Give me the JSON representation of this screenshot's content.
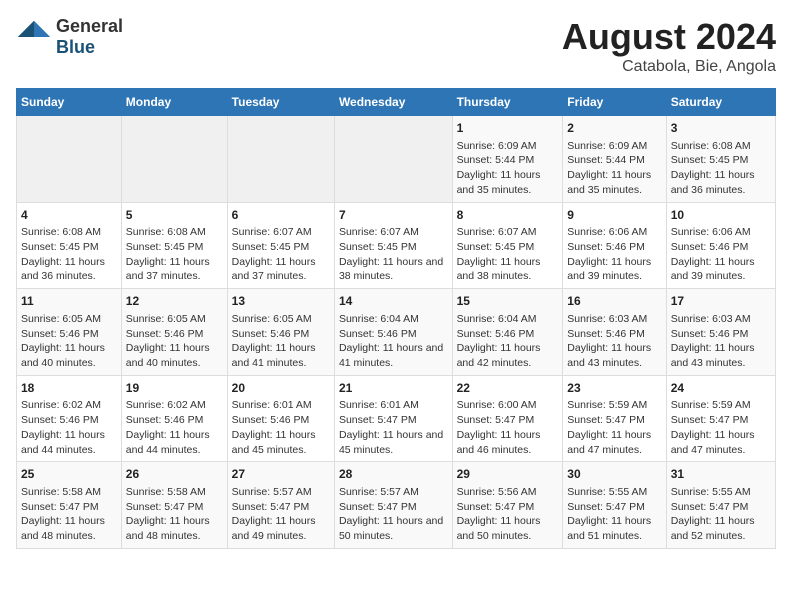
{
  "logo": {
    "general": "General",
    "blue": "Blue"
  },
  "title": "August 2024",
  "subtitle": "Catabola, Bie, Angola",
  "days_header": [
    "Sunday",
    "Monday",
    "Tuesday",
    "Wednesday",
    "Thursday",
    "Friday",
    "Saturday"
  ],
  "weeks": [
    [
      {
        "day": "",
        "info": ""
      },
      {
        "day": "",
        "info": ""
      },
      {
        "day": "",
        "info": ""
      },
      {
        "day": "",
        "info": ""
      },
      {
        "day": "1",
        "info": "Sunrise: 6:09 AM\nSunset: 5:44 PM\nDaylight: 11 hours and 35 minutes."
      },
      {
        "day": "2",
        "info": "Sunrise: 6:09 AM\nSunset: 5:44 PM\nDaylight: 11 hours and 35 minutes."
      },
      {
        "day": "3",
        "info": "Sunrise: 6:08 AM\nSunset: 5:45 PM\nDaylight: 11 hours and 36 minutes."
      }
    ],
    [
      {
        "day": "4",
        "info": "Sunrise: 6:08 AM\nSunset: 5:45 PM\nDaylight: 11 hours and 36 minutes."
      },
      {
        "day": "5",
        "info": "Sunrise: 6:08 AM\nSunset: 5:45 PM\nDaylight: 11 hours and 37 minutes."
      },
      {
        "day": "6",
        "info": "Sunrise: 6:07 AM\nSunset: 5:45 PM\nDaylight: 11 hours and 37 minutes."
      },
      {
        "day": "7",
        "info": "Sunrise: 6:07 AM\nSunset: 5:45 PM\nDaylight: 11 hours and 38 minutes."
      },
      {
        "day": "8",
        "info": "Sunrise: 6:07 AM\nSunset: 5:45 PM\nDaylight: 11 hours and 38 minutes."
      },
      {
        "day": "9",
        "info": "Sunrise: 6:06 AM\nSunset: 5:46 PM\nDaylight: 11 hours and 39 minutes."
      },
      {
        "day": "10",
        "info": "Sunrise: 6:06 AM\nSunset: 5:46 PM\nDaylight: 11 hours and 39 minutes."
      }
    ],
    [
      {
        "day": "11",
        "info": "Sunrise: 6:05 AM\nSunset: 5:46 PM\nDaylight: 11 hours and 40 minutes."
      },
      {
        "day": "12",
        "info": "Sunrise: 6:05 AM\nSunset: 5:46 PM\nDaylight: 11 hours and 40 minutes."
      },
      {
        "day": "13",
        "info": "Sunrise: 6:05 AM\nSunset: 5:46 PM\nDaylight: 11 hours and 41 minutes."
      },
      {
        "day": "14",
        "info": "Sunrise: 6:04 AM\nSunset: 5:46 PM\nDaylight: 11 hours and 41 minutes."
      },
      {
        "day": "15",
        "info": "Sunrise: 6:04 AM\nSunset: 5:46 PM\nDaylight: 11 hours and 42 minutes."
      },
      {
        "day": "16",
        "info": "Sunrise: 6:03 AM\nSunset: 5:46 PM\nDaylight: 11 hours and 43 minutes."
      },
      {
        "day": "17",
        "info": "Sunrise: 6:03 AM\nSunset: 5:46 PM\nDaylight: 11 hours and 43 minutes."
      }
    ],
    [
      {
        "day": "18",
        "info": "Sunrise: 6:02 AM\nSunset: 5:46 PM\nDaylight: 11 hours and 44 minutes."
      },
      {
        "day": "19",
        "info": "Sunrise: 6:02 AM\nSunset: 5:46 PM\nDaylight: 11 hours and 44 minutes."
      },
      {
        "day": "20",
        "info": "Sunrise: 6:01 AM\nSunset: 5:46 PM\nDaylight: 11 hours and 45 minutes."
      },
      {
        "day": "21",
        "info": "Sunrise: 6:01 AM\nSunset: 5:47 PM\nDaylight: 11 hours and 45 minutes."
      },
      {
        "day": "22",
        "info": "Sunrise: 6:00 AM\nSunset: 5:47 PM\nDaylight: 11 hours and 46 minutes."
      },
      {
        "day": "23",
        "info": "Sunrise: 5:59 AM\nSunset: 5:47 PM\nDaylight: 11 hours and 47 minutes."
      },
      {
        "day": "24",
        "info": "Sunrise: 5:59 AM\nSunset: 5:47 PM\nDaylight: 11 hours and 47 minutes."
      }
    ],
    [
      {
        "day": "25",
        "info": "Sunrise: 5:58 AM\nSunset: 5:47 PM\nDaylight: 11 hours and 48 minutes."
      },
      {
        "day": "26",
        "info": "Sunrise: 5:58 AM\nSunset: 5:47 PM\nDaylight: 11 hours and 48 minutes."
      },
      {
        "day": "27",
        "info": "Sunrise: 5:57 AM\nSunset: 5:47 PM\nDaylight: 11 hours and 49 minutes."
      },
      {
        "day": "28",
        "info": "Sunrise: 5:57 AM\nSunset: 5:47 PM\nDaylight: 11 hours and 50 minutes."
      },
      {
        "day": "29",
        "info": "Sunrise: 5:56 AM\nSunset: 5:47 PM\nDaylight: 11 hours and 50 minutes."
      },
      {
        "day": "30",
        "info": "Sunrise: 5:55 AM\nSunset: 5:47 PM\nDaylight: 11 hours and 51 minutes."
      },
      {
        "day": "31",
        "info": "Sunrise: 5:55 AM\nSunset: 5:47 PM\nDaylight: 11 hours and 52 minutes."
      }
    ]
  ]
}
